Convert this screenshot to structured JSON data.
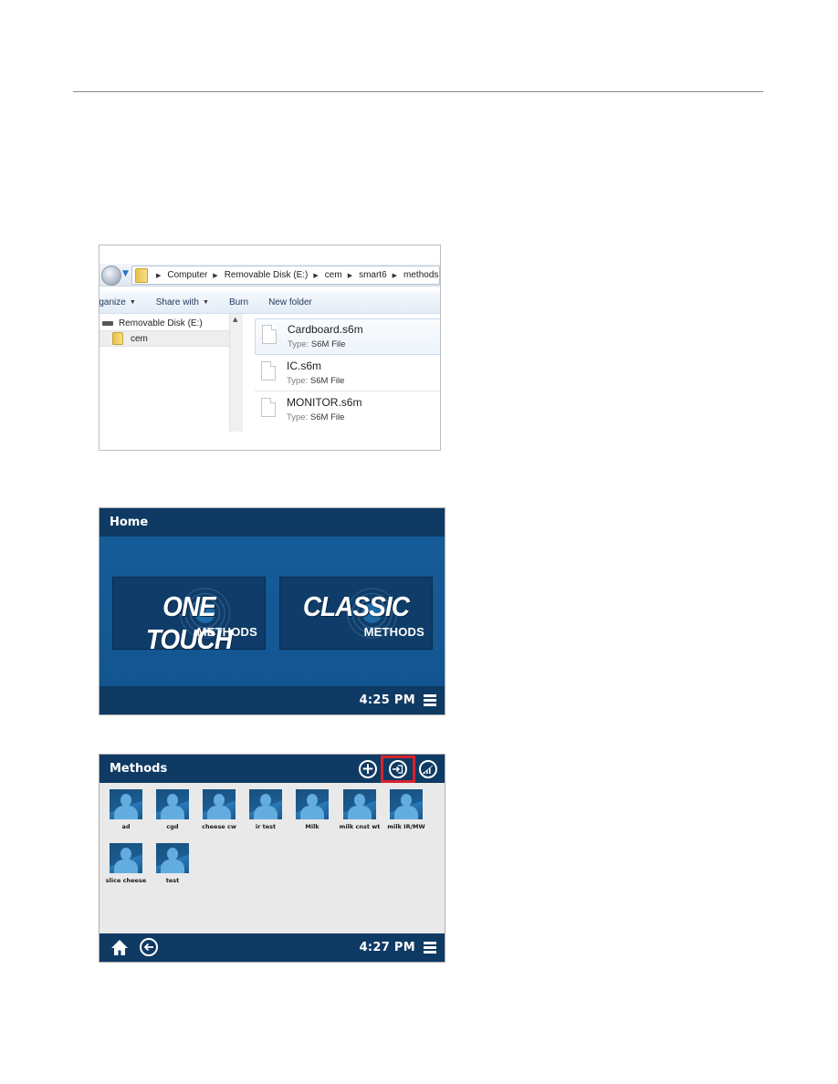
{
  "explorer": {
    "breadcrumb": [
      "Computer",
      "Removable Disk (E:)",
      "cem",
      "smart6",
      "methods"
    ],
    "toolbar": {
      "organize": "rganize",
      "share_with": "Share with",
      "burn": "Burn",
      "new_folder": "New folder"
    },
    "nav_tree": [
      {
        "label": "Removable Disk (E:)",
        "icon": "drive-icon"
      },
      {
        "label": "cem",
        "icon": "folder-icon",
        "selected": true
      }
    ],
    "files": [
      {
        "name": "Cardboard.s6m",
        "type_label": "Type:",
        "type": "S6M File",
        "selected": true
      },
      {
        "name": "IC.s6m",
        "type_label": "Type:",
        "type": "S6M File"
      },
      {
        "name": "MONITOR.s6m",
        "type_label": "Type:",
        "type": "S6M File"
      }
    ]
  },
  "home_screen": {
    "title": "Home",
    "tiles": [
      {
        "big": "ONE TOUCH",
        "small": "METHODS"
      },
      {
        "big": "CLASSIC",
        "small": "METHODS"
      }
    ],
    "time": "4:25 PM"
  },
  "methods_screen": {
    "title": "Methods",
    "header_icons": [
      "add-icon",
      "import-icon",
      "analytics-icon"
    ],
    "highlighted_icon": "import-icon",
    "highlight_color": "#d7232c",
    "methods": [
      "ad",
      "cgd",
      "cheese cw",
      "ir test",
      "Milk",
      "milk cnst wt",
      "milk IR/MW",
      "slice cheese",
      "test"
    ],
    "time": "4:27 PM"
  },
  "colors": {
    "header_bar": "#0f3a63",
    "home_body": "#135893",
    "methods_body": "#e9e9e9"
  }
}
